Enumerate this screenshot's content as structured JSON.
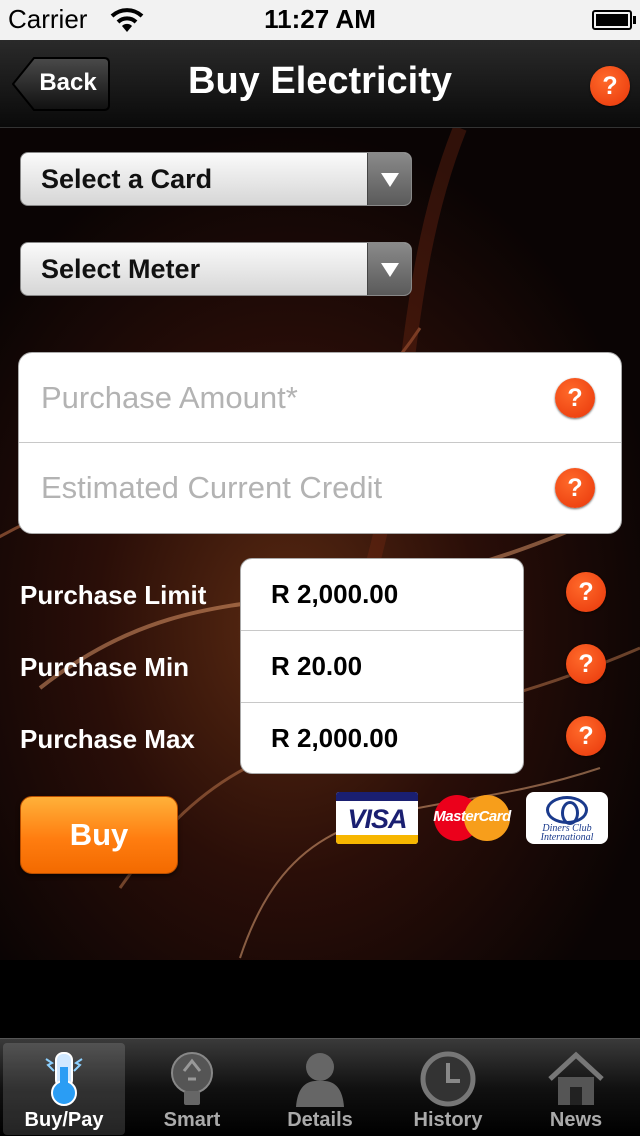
{
  "status_bar": {
    "carrier": "Carrier",
    "time": "11:27 AM"
  },
  "nav": {
    "back_label": "Back",
    "title": "Buy Electricity"
  },
  "form": {
    "select_card": "Select a Card",
    "select_meter": "Select Meter",
    "purchase_amount_placeholder": "Purchase Amount*",
    "estimated_credit_placeholder": "Estimated Current Credit"
  },
  "help_glyph": "?",
  "limits": [
    {
      "label": "Purchase Limit",
      "value": "R 2,000.00"
    },
    {
      "label": "Purchase Min",
      "value": "R 20.00"
    },
    {
      "label": "Purchase Max",
      "value": "R 2,000.00"
    }
  ],
  "buy_label": "Buy",
  "card_logos": {
    "visa": "VISA",
    "mastercard": "MasterCard",
    "diners_line1": "Diners Club",
    "diners_line2": "International"
  },
  "tabs": [
    {
      "label": "Buy/Pay",
      "icon": "meter-icon",
      "active": true
    },
    {
      "label": "Smart",
      "icon": "recycle-bulb-icon",
      "active": false
    },
    {
      "label": "Details",
      "icon": "person-icon",
      "active": false
    },
    {
      "label": "History",
      "icon": "clock-icon",
      "active": false
    },
    {
      "label": "News",
      "icon": "house-icon",
      "active": false
    }
  ],
  "colors": {
    "accent": "#ff7d10",
    "help": "#e8360a",
    "background": "#0a0404"
  }
}
